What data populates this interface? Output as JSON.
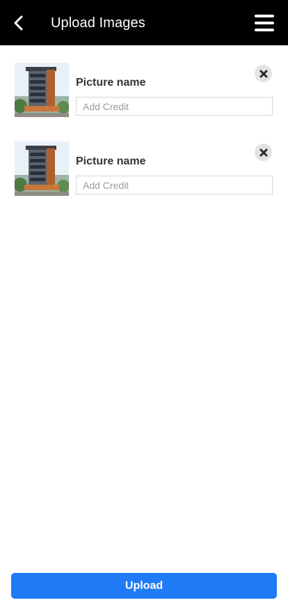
{
  "header": {
    "title": "Upload Images",
    "back_icon": "chevron-left-icon",
    "menu_icon": "hamburger-menu-icon"
  },
  "items": [
    {
      "name": "Picture name",
      "credit_placeholder": "Add Credit",
      "credit_value": "",
      "remove_icon": "close-icon"
    },
    {
      "name": "Picture name",
      "credit_placeholder": "Add Credit",
      "credit_value": "",
      "remove_icon": "close-icon"
    }
  ],
  "upload": {
    "label": "Upload"
  },
  "colors": {
    "header_bg": "#000000",
    "header_text": "#ffffff",
    "accent": "#1f7bf6",
    "remove_bg": "#e3e3e3"
  }
}
